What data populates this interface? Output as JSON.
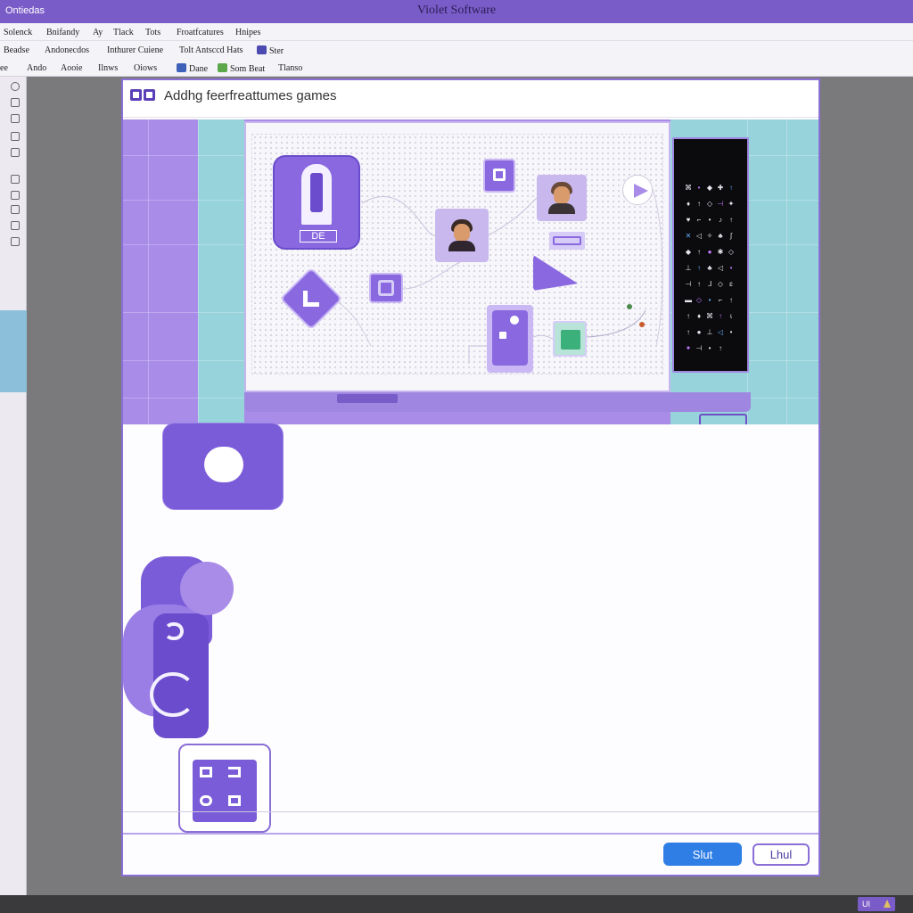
{
  "window": {
    "app_left": "Ontiedas",
    "title": "Violet Software"
  },
  "menubar": [
    "Solenck",
    "Bnifandy",
    "Ay",
    "Tlack",
    "Tots",
    "Froatfcatures",
    "Hnipes"
  ],
  "toolbar1": [
    "Beadse",
    "Andonecdos",
    "Inthurer Cuiene",
    "Tolt Antsccd Hats",
    "Ster"
  ],
  "toolbar2": [
    "ee",
    "Ando",
    "Aooie",
    "Ilnws",
    "Oiows",
    "Dane",
    "Som Beat",
    "Tlanso"
  ],
  "dialog": {
    "title": "Addhg feerfreattumes games",
    "primary_button": "Slut",
    "secondary_button": "Lhul"
  },
  "bigapp_label": "DE",
  "status_badge": "UI",
  "terminal_glyphs": [
    "⌘",
    "•",
    "◆",
    "✚",
    "↑",
    "♦",
    "↑",
    "◇",
    "⊣",
    "✦",
    "♥",
    "⌐",
    "•",
    "♪",
    "↑",
    "✕",
    "◁",
    "✧",
    "♣",
    "ʃ",
    "◆",
    "↑",
    "●",
    "✱",
    "◇",
    "⊥",
    "↑",
    "♣",
    "◁",
    "•",
    "⊣",
    "↑",
    "ᒧ",
    "◇",
    "ɛ",
    "▬",
    "◇",
    "•",
    "⌐",
    "↑",
    "↑",
    "♦",
    "⌘",
    "↑",
    "ɩ",
    "↑",
    "●",
    "⊥",
    "◁",
    "•",
    "✦",
    "⊣",
    "•",
    "↑"
  ],
  "colors": {
    "accent": "#7a5cc8",
    "primary_button": "#2f7ee6",
    "stage_teal": "#97d3db"
  }
}
